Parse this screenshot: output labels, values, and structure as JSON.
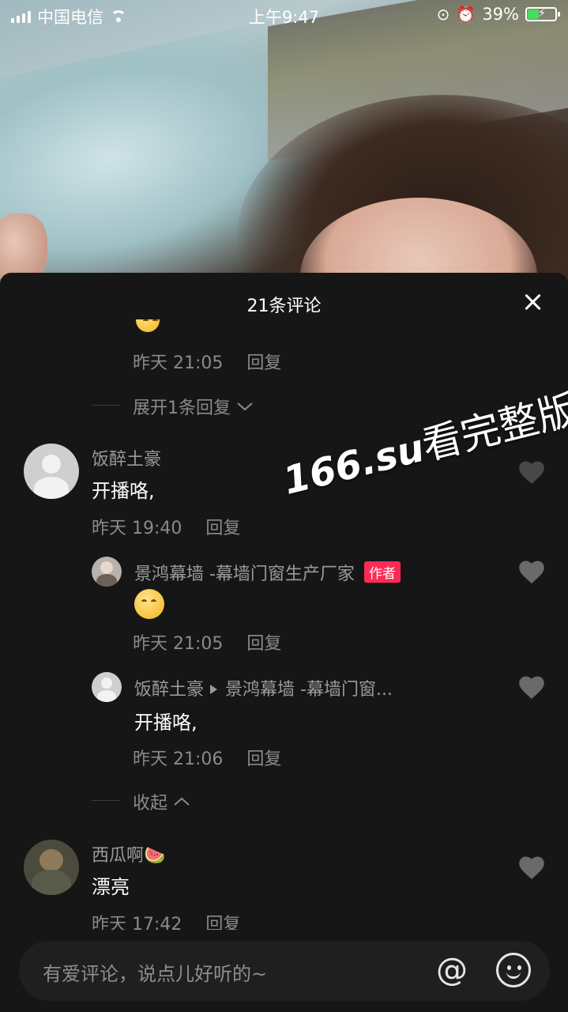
{
  "status_bar": {
    "carrier": "中国电信",
    "time": "上午9:47",
    "battery_percent": "39%"
  },
  "sheet": {
    "title": "21条评论",
    "close_icon": "close-icon"
  },
  "comments": {
    "top_reply_meta": {
      "time": "昨天 21:05",
      "reply": "回复"
    },
    "expand_more": "展开1条回复",
    "c1": {
      "username": "饭醉土豪",
      "text": "开播咯,",
      "time": "昨天 19:40",
      "reply": "回复",
      "replies": [
        {
          "username": "景鸿幕墙 -幕墙门窗生产厂家",
          "badge": "作者",
          "time": "昨天 21:05",
          "reply": "回复"
        },
        {
          "username": "饭醉土豪",
          "target": "景鸿幕墙 -幕墙门窗...",
          "text": "开播咯,",
          "time": "昨天 21:06",
          "reply": "回复"
        }
      ],
      "collapse": "收起"
    },
    "c2": {
      "username": "西瓜啊🍉",
      "text": "漂亮",
      "time": "昨天 17:42",
      "reply": "回复"
    }
  },
  "watermark": {
    "latin": "166.su",
    "cn": "看完整版"
  },
  "input": {
    "placeholder": "有爱评论，说点儿好听的~",
    "at_symbol": "@"
  },
  "colors": {
    "background": "#161616",
    "author_badge": "#fe2c55",
    "secondary_text": "#8a8a8a"
  }
}
